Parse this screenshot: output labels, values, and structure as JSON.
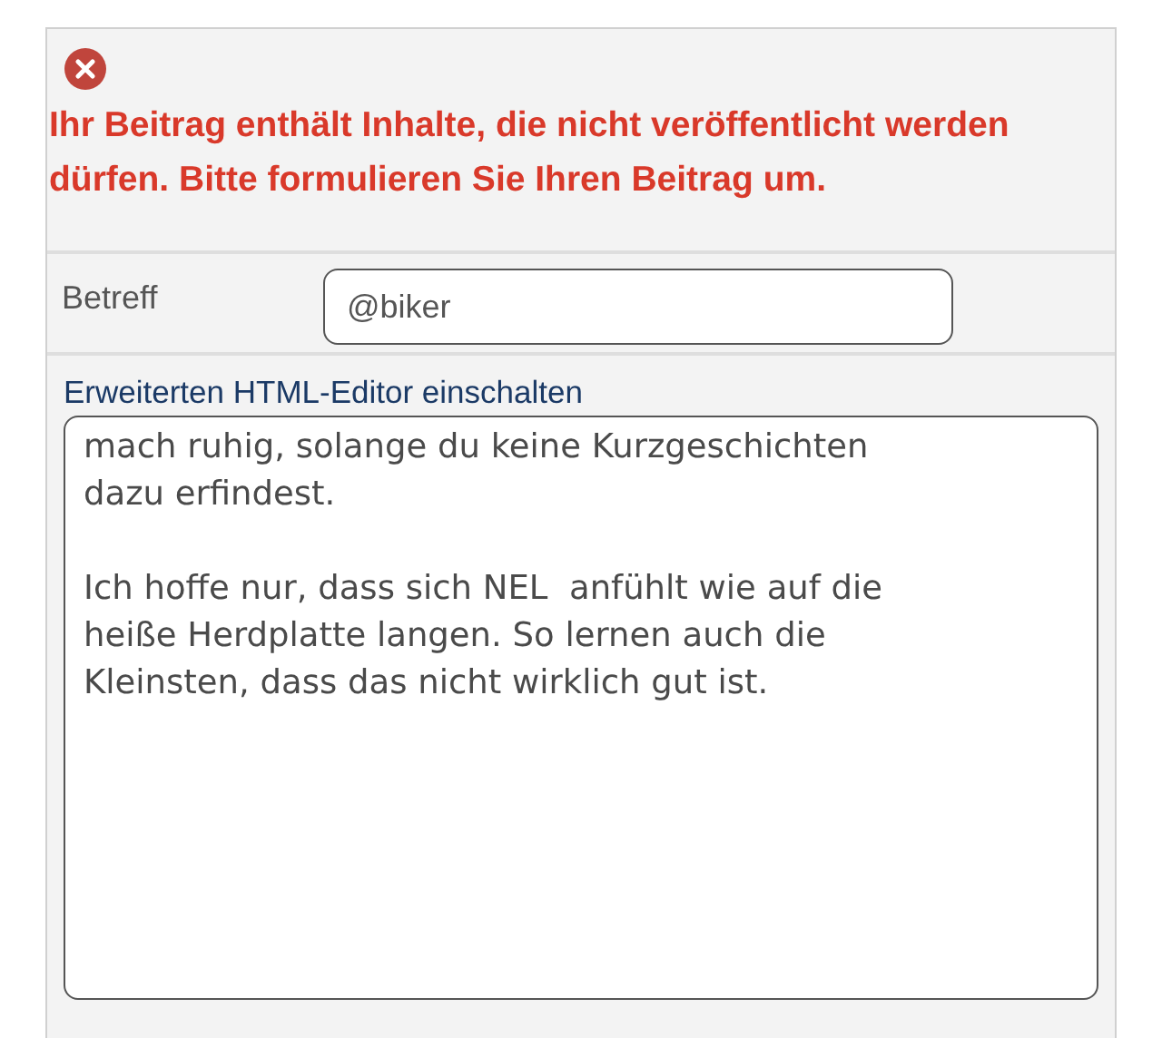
{
  "error": {
    "message": "Ihr Beitrag enthält Inhalte, die nicht veröffentlicht werden dürfen. Bitte formulieren Sie Ihren Beitrag um."
  },
  "subject": {
    "label": "Betreff",
    "value": "@biker"
  },
  "editor_toggle": "Erweiterten HTML-Editor einschalten",
  "message": {
    "value": "mach ruhig, solange du keine Kurzgeschichten\ndazu erfindest.\n\nIch hoffe nur, dass sich NEL  anfühlt wie auf die\nheiße Herdplatte langen. So lernen auch die\nKleinsten, dass das nicht wirklich gut ist."
  }
}
